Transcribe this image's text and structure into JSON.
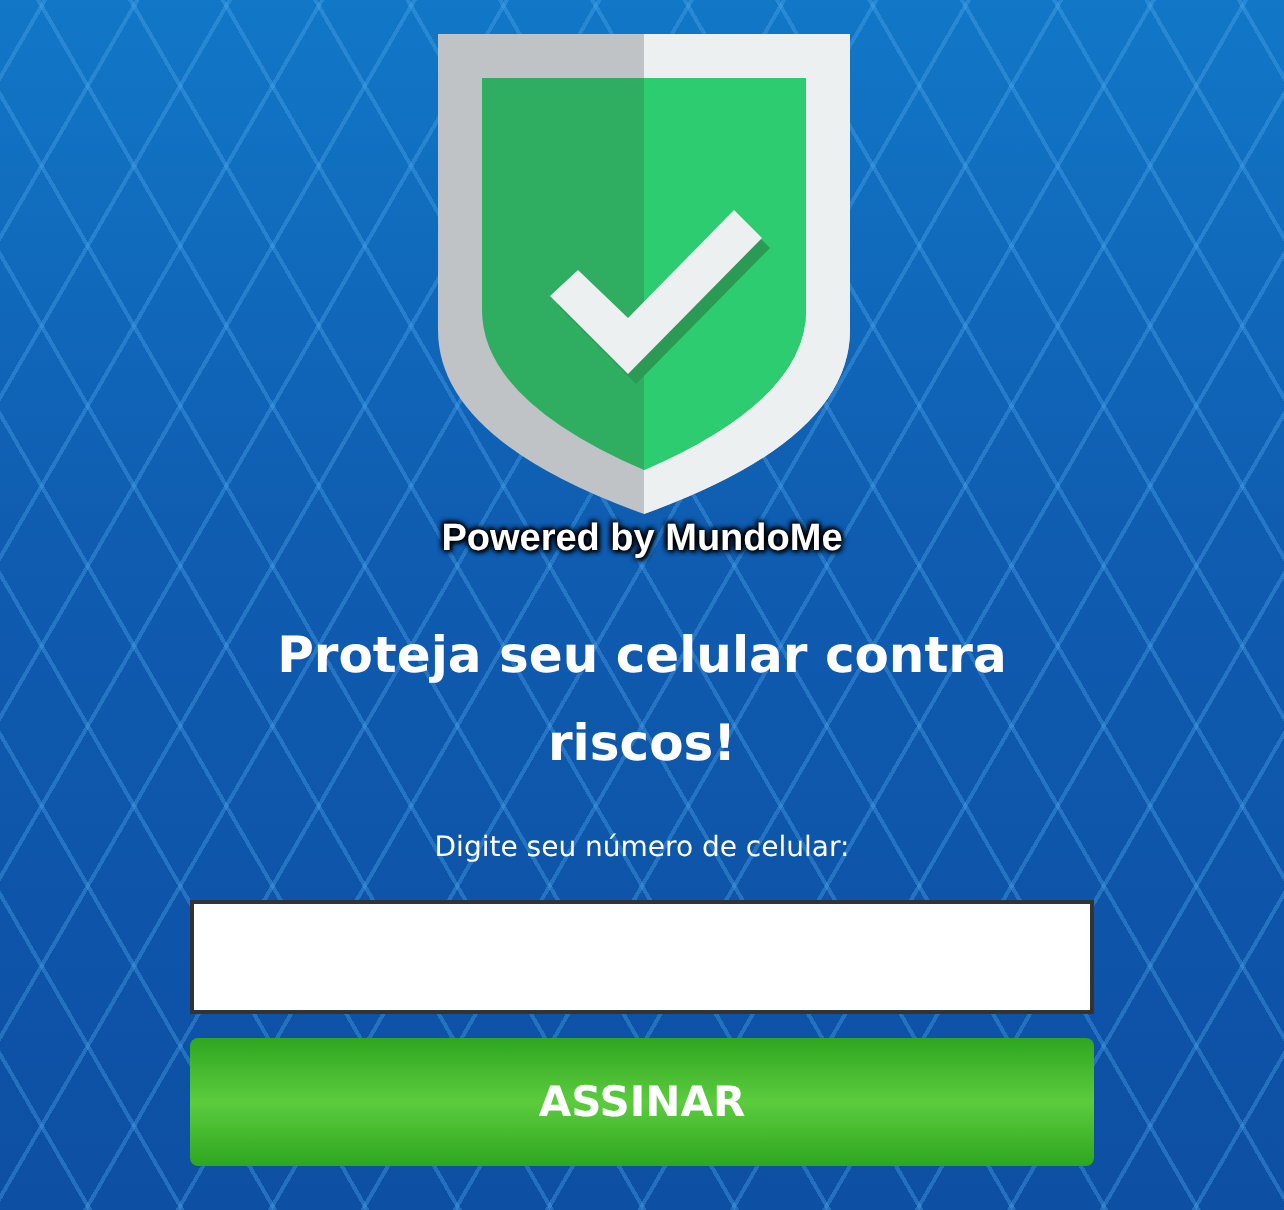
{
  "badge": {
    "caption": "Powered by MundoMe"
  },
  "heading": "Proteja seu celular contra riscos!",
  "phone": {
    "label": "Digite seu número de celular:"
  },
  "submit": {
    "label": "ASSINAR"
  }
}
